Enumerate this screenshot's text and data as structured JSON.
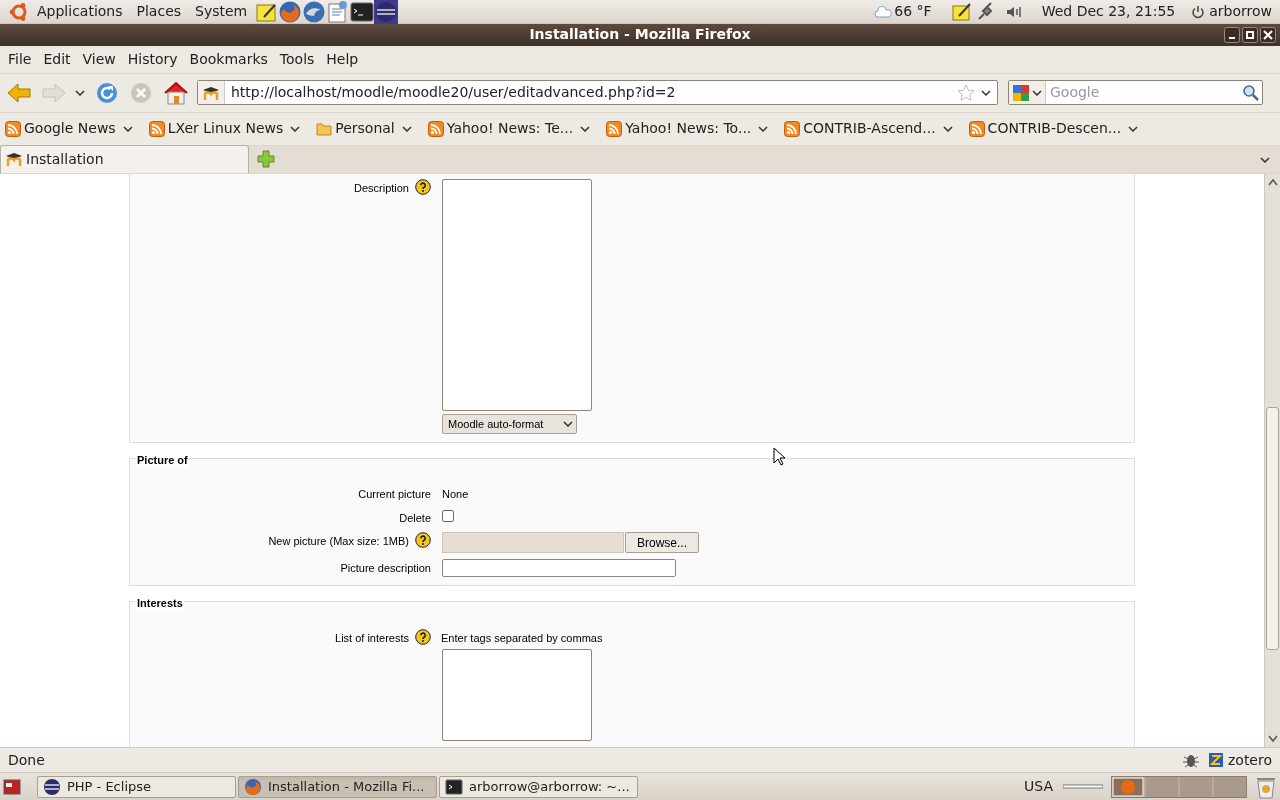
{
  "top_panel": {
    "menus": [
      "Applications",
      "Places",
      "System"
    ],
    "weather": "66 °F",
    "clock": "Wed Dec 23, 21:55",
    "user": "arborrow"
  },
  "window": {
    "title": "Installation - Mozilla Firefox"
  },
  "menu_bar": [
    "File",
    "Edit",
    "View",
    "History",
    "Bookmarks",
    "Tools",
    "Help"
  ],
  "navigation": {
    "url": "http://localhost/moodle/moodle20/user/editadvanced.php?id=2",
    "search_placeholder": "Google"
  },
  "bookmarks": [
    {
      "label": "Google News",
      "kind": "feed"
    },
    {
      "label": "LXer Linux News",
      "kind": "feed"
    },
    {
      "label": "Personal",
      "kind": "folder"
    },
    {
      "label": "Yahoo! News: Te...",
      "kind": "feed"
    },
    {
      "label": "Yahoo! News: To...",
      "kind": "feed"
    },
    {
      "label": "CONTRIB-Ascend...",
      "kind": "feed"
    },
    {
      "label": "CONTRIB-Descen...",
      "kind": "feed"
    }
  ],
  "tabs": [
    {
      "label": "Installation",
      "selected": true
    }
  ],
  "form": {
    "sections": [
      {
        "fields": [
          {
            "kind": "editor",
            "label": "Description",
            "help": true,
            "format": "Moodle auto-format"
          }
        ]
      },
      {
        "legend": "Picture of",
        "fields": [
          {
            "kind": "static",
            "label": "Current picture",
            "help": false,
            "value": "None"
          },
          {
            "kind": "checkbox",
            "label": "Delete",
            "help": false,
            "checked": false
          },
          {
            "kind": "file",
            "label": "New picture (Max size: 1MB)",
            "help": true,
            "button": "Browse..."
          },
          {
            "kind": "text",
            "label": "Picture description",
            "help": false
          }
        ]
      },
      {
        "legend": "Interests",
        "fields": [
          {
            "kind": "tags",
            "label": "List of interests",
            "help": true,
            "hint": "Enter tags separated by commas"
          }
        ]
      }
    ]
  },
  "status_bar": {
    "text": "Done",
    "addon": "zotero"
  },
  "taskbar": {
    "items": [
      {
        "label": "PHP - Eclipse",
        "selected": false
      },
      {
        "label": "Installation - Mozilla Fi...",
        "selected": true
      },
      {
        "label": "arborrow@arborrow: ~...",
        "selected": false
      }
    ],
    "keyboard": "USA"
  }
}
